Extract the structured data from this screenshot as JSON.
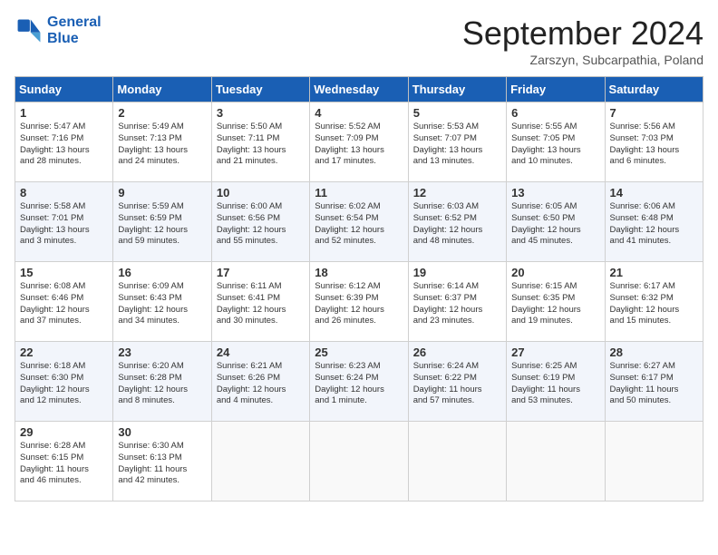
{
  "header": {
    "logo_line1": "General",
    "logo_line2": "Blue",
    "month": "September 2024",
    "location": "Zarszyn, Subcarpathia, Poland"
  },
  "days_of_week": [
    "Sunday",
    "Monday",
    "Tuesday",
    "Wednesday",
    "Thursday",
    "Friday",
    "Saturday"
  ],
  "weeks": [
    [
      {
        "day": "1",
        "lines": [
          "Sunrise: 5:47 AM",
          "Sunset: 7:16 PM",
          "Daylight: 13 hours",
          "and 28 minutes."
        ]
      },
      {
        "day": "2",
        "lines": [
          "Sunrise: 5:49 AM",
          "Sunset: 7:13 PM",
          "Daylight: 13 hours",
          "and 24 minutes."
        ]
      },
      {
        "day": "3",
        "lines": [
          "Sunrise: 5:50 AM",
          "Sunset: 7:11 PM",
          "Daylight: 13 hours",
          "and 21 minutes."
        ]
      },
      {
        "day": "4",
        "lines": [
          "Sunrise: 5:52 AM",
          "Sunset: 7:09 PM",
          "Daylight: 13 hours",
          "and 17 minutes."
        ]
      },
      {
        "day": "5",
        "lines": [
          "Sunrise: 5:53 AM",
          "Sunset: 7:07 PM",
          "Daylight: 13 hours",
          "and 13 minutes."
        ]
      },
      {
        "day": "6",
        "lines": [
          "Sunrise: 5:55 AM",
          "Sunset: 7:05 PM",
          "Daylight: 13 hours",
          "and 10 minutes."
        ]
      },
      {
        "day": "7",
        "lines": [
          "Sunrise: 5:56 AM",
          "Sunset: 7:03 PM",
          "Daylight: 13 hours",
          "and 6 minutes."
        ]
      }
    ],
    [
      {
        "day": "8",
        "lines": [
          "Sunrise: 5:58 AM",
          "Sunset: 7:01 PM",
          "Daylight: 13 hours",
          "and 3 minutes."
        ]
      },
      {
        "day": "9",
        "lines": [
          "Sunrise: 5:59 AM",
          "Sunset: 6:59 PM",
          "Daylight: 12 hours",
          "and 59 minutes."
        ]
      },
      {
        "day": "10",
        "lines": [
          "Sunrise: 6:00 AM",
          "Sunset: 6:56 PM",
          "Daylight: 12 hours",
          "and 55 minutes."
        ]
      },
      {
        "day": "11",
        "lines": [
          "Sunrise: 6:02 AM",
          "Sunset: 6:54 PM",
          "Daylight: 12 hours",
          "and 52 minutes."
        ]
      },
      {
        "day": "12",
        "lines": [
          "Sunrise: 6:03 AM",
          "Sunset: 6:52 PM",
          "Daylight: 12 hours",
          "and 48 minutes."
        ]
      },
      {
        "day": "13",
        "lines": [
          "Sunrise: 6:05 AM",
          "Sunset: 6:50 PM",
          "Daylight: 12 hours",
          "and 45 minutes."
        ]
      },
      {
        "day": "14",
        "lines": [
          "Sunrise: 6:06 AM",
          "Sunset: 6:48 PM",
          "Daylight: 12 hours",
          "and 41 minutes."
        ]
      }
    ],
    [
      {
        "day": "15",
        "lines": [
          "Sunrise: 6:08 AM",
          "Sunset: 6:46 PM",
          "Daylight: 12 hours",
          "and 37 minutes."
        ]
      },
      {
        "day": "16",
        "lines": [
          "Sunrise: 6:09 AM",
          "Sunset: 6:43 PM",
          "Daylight: 12 hours",
          "and 34 minutes."
        ]
      },
      {
        "day": "17",
        "lines": [
          "Sunrise: 6:11 AM",
          "Sunset: 6:41 PM",
          "Daylight: 12 hours",
          "and 30 minutes."
        ]
      },
      {
        "day": "18",
        "lines": [
          "Sunrise: 6:12 AM",
          "Sunset: 6:39 PM",
          "Daylight: 12 hours",
          "and 26 minutes."
        ]
      },
      {
        "day": "19",
        "lines": [
          "Sunrise: 6:14 AM",
          "Sunset: 6:37 PM",
          "Daylight: 12 hours",
          "and 23 minutes."
        ]
      },
      {
        "day": "20",
        "lines": [
          "Sunrise: 6:15 AM",
          "Sunset: 6:35 PM",
          "Daylight: 12 hours",
          "and 19 minutes."
        ]
      },
      {
        "day": "21",
        "lines": [
          "Sunrise: 6:17 AM",
          "Sunset: 6:32 PM",
          "Daylight: 12 hours",
          "and 15 minutes."
        ]
      }
    ],
    [
      {
        "day": "22",
        "lines": [
          "Sunrise: 6:18 AM",
          "Sunset: 6:30 PM",
          "Daylight: 12 hours",
          "and 12 minutes."
        ]
      },
      {
        "day": "23",
        "lines": [
          "Sunrise: 6:20 AM",
          "Sunset: 6:28 PM",
          "Daylight: 12 hours",
          "and 8 minutes."
        ]
      },
      {
        "day": "24",
        "lines": [
          "Sunrise: 6:21 AM",
          "Sunset: 6:26 PM",
          "Daylight: 12 hours",
          "and 4 minutes."
        ]
      },
      {
        "day": "25",
        "lines": [
          "Sunrise: 6:23 AM",
          "Sunset: 6:24 PM",
          "Daylight: 12 hours",
          "and 1 minute."
        ]
      },
      {
        "day": "26",
        "lines": [
          "Sunrise: 6:24 AM",
          "Sunset: 6:22 PM",
          "Daylight: 11 hours",
          "and 57 minutes."
        ]
      },
      {
        "day": "27",
        "lines": [
          "Sunrise: 6:25 AM",
          "Sunset: 6:19 PM",
          "Daylight: 11 hours",
          "and 53 minutes."
        ]
      },
      {
        "day": "28",
        "lines": [
          "Sunrise: 6:27 AM",
          "Sunset: 6:17 PM",
          "Daylight: 11 hours",
          "and 50 minutes."
        ]
      }
    ],
    [
      {
        "day": "29",
        "lines": [
          "Sunrise: 6:28 AM",
          "Sunset: 6:15 PM",
          "Daylight: 11 hours",
          "and 46 minutes."
        ]
      },
      {
        "day": "30",
        "lines": [
          "Sunrise: 6:30 AM",
          "Sunset: 6:13 PM",
          "Daylight: 11 hours",
          "and 42 minutes."
        ]
      },
      {
        "day": "",
        "lines": []
      },
      {
        "day": "",
        "lines": []
      },
      {
        "day": "",
        "lines": []
      },
      {
        "day": "",
        "lines": []
      },
      {
        "day": "",
        "lines": []
      }
    ]
  ]
}
